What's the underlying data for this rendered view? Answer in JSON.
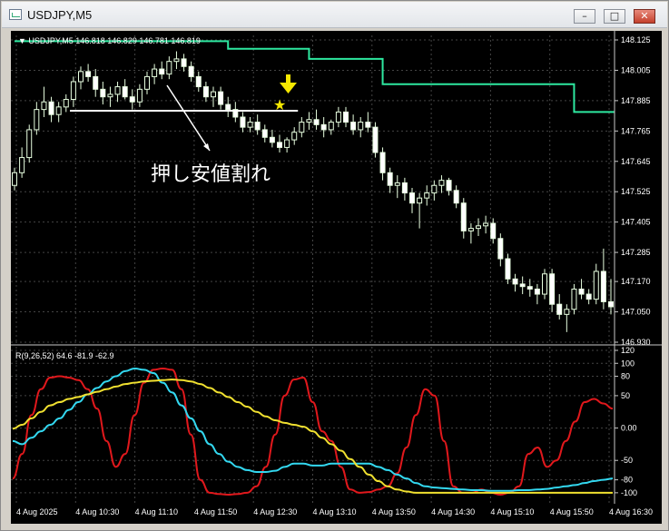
{
  "window": {
    "title": "USDJPY,M5",
    "buttons": {
      "minimize": "–",
      "maximize": "□",
      "close": "✕"
    }
  },
  "price_panel": {
    "header": "▼ USDJPY,M5  146.818 146.829 146.781 146.819"
  },
  "indicator_panel": {
    "header": "R(9,26,52) 64.6 -81.9 -62.9"
  },
  "annotations": {
    "text": "押し安値割れ",
    "star": "★",
    "down_arrow": "down-arrow"
  },
  "colors": {
    "background": "#000000",
    "grid": "#444444",
    "bull_candle": "#e8ffe0",
    "bear_candle": "#ffffff",
    "resistance_line": "#2ee8a0",
    "rci_short": "#e0181c",
    "rci_mid": "#33d8f0",
    "rci_long": "#f0e030",
    "annotation": "#f6e800"
  },
  "chart_data": [
    {
      "type": "candlestick",
      "title": "USDJPY,M5",
      "ylim": [
        146.93,
        148.125
      ],
      "y_ticks": [
        "148.125",
        "148.005",
        "147.885",
        "147.765",
        "147.645",
        "147.525",
        "147.405",
        "147.285",
        "147.170",
        "147.050",
        "146.930"
      ],
      "x_ticks": [
        "4 Aug 2025",
        "4 Aug 10:30",
        "4 Aug 11:10",
        "4 Aug 11:50",
        "4 Aug 12:30",
        "4 Aug 13:10",
        "4 Aug 13:50",
        "4 Aug 14:30",
        "4 Aug 15:10",
        "4 Aug 15:50",
        "4 Aug 16:30"
      ],
      "grid": true,
      "series": [
        {
          "name": "candles",
          "ohlc": [
            [
              147.55,
              147.62,
              147.53,
              147.6
            ],
            [
              147.6,
              147.7,
              147.58,
              147.66
            ],
            [
              147.66,
              147.79,
              147.64,
              147.77
            ],
            [
              147.77,
              147.88,
              147.75,
              147.85
            ],
            [
              147.85,
              147.94,
              147.82,
              147.88
            ],
            [
              147.88,
              147.9,
              147.8,
              147.83
            ],
            [
              147.83,
              147.88,
              147.8,
              147.86
            ],
            [
              147.86,
              147.91,
              147.84,
              147.89
            ],
            [
              147.89,
              147.98,
              147.86,
              147.96
            ],
            [
              147.96,
              148.02,
              147.93,
              148.0
            ],
            [
              148.0,
              148.03,
              147.96,
              147.98
            ],
            [
              147.98,
              148.01,
              147.9,
              147.93
            ],
            [
              147.93,
              147.96,
              147.87,
              147.9
            ],
            [
              147.9,
              147.94,
              147.86,
              147.91
            ],
            [
              147.91,
              147.96,
              147.88,
              147.94
            ],
            [
              147.94,
              147.97,
              147.89,
              147.9
            ],
            [
              147.9,
              147.93,
              147.85,
              147.88
            ],
            [
              147.88,
              147.95,
              147.86,
              147.93
            ],
            [
              147.93,
              148.0,
              147.91,
              147.98
            ],
            [
              147.98,
              148.03,
              147.95,
              148.01
            ],
            [
              148.01,
              148.04,
              147.97,
              147.99
            ],
            [
              147.99,
              148.06,
              147.97,
              148.04
            ],
            [
              148.04,
              148.08,
              148.01,
              148.05
            ],
            [
              148.05,
              148.07,
              148.0,
              148.02
            ],
            [
              148.02,
              148.04,
              147.96,
              147.98
            ],
            [
              147.98,
              148.0,
              147.92,
              147.94
            ],
            [
              147.94,
              147.96,
              147.88,
              147.9
            ],
            [
              147.9,
              147.94,
              147.86,
              147.92
            ],
            [
              147.92,
              147.94,
              147.85,
              147.87
            ],
            [
              147.87,
              147.9,
              147.82,
              147.85
            ],
            [
              147.85,
              147.88,
              147.8,
              147.82
            ],
            [
              147.82,
              147.84,
              147.76,
              147.78
            ],
            [
              147.78,
              147.82,
              147.76,
              147.8
            ],
            [
              147.8,
              147.83,
              147.75,
              147.77
            ],
            [
              147.77,
              147.79,
              147.72,
              147.74
            ],
            [
              147.74,
              147.77,
              147.7,
              147.72
            ],
            [
              147.72,
              147.75,
              147.68,
              147.7
            ],
            [
              147.7,
              147.74,
              147.68,
              147.73
            ],
            [
              147.73,
              147.78,
              147.71,
              147.76
            ],
            [
              147.76,
              147.82,
              147.74,
              147.8
            ],
            [
              147.8,
              147.84,
              147.77,
              147.81
            ],
            [
              147.81,
              147.85,
              147.77,
              147.79
            ],
            [
              147.79,
              147.82,
              147.74,
              147.77
            ],
            [
              147.77,
              147.81,
              147.75,
              147.8
            ],
            [
              147.8,
              147.86,
              147.78,
              147.84
            ],
            [
              147.84,
              147.86,
              147.78,
              147.8
            ],
            [
              147.8,
              147.83,
              147.75,
              147.77
            ],
            [
              147.77,
              147.82,
              147.74,
              147.8
            ],
            [
              147.8,
              147.84,
              147.76,
              147.78
            ],
            [
              147.78,
              147.8,
              147.66,
              147.68
            ],
            [
              147.68,
              147.7,
              147.57,
              147.6
            ],
            [
              147.6,
              147.62,
              147.52,
              147.55
            ],
            [
              147.55,
              147.59,
              147.5,
              147.56
            ],
            [
              147.56,
              147.58,
              147.49,
              147.52
            ],
            [
              147.52,
              147.54,
              147.44,
              147.48
            ],
            [
              147.48,
              147.52,
              147.38,
              147.5
            ],
            [
              147.5,
              147.55,
              147.47,
              147.52
            ],
            [
              147.52,
              147.57,
              147.49,
              147.55
            ],
            [
              147.55,
              147.59,
              147.52,
              147.57
            ],
            [
              147.57,
              147.58,
              147.51,
              147.53
            ],
            [
              147.53,
              147.55,
              147.46,
              147.48
            ],
            [
              147.48,
              147.5,
              147.34,
              147.37
            ],
            [
              147.37,
              147.4,
              147.32,
              147.38
            ],
            [
              147.38,
              147.42,
              147.35,
              147.39
            ],
            [
              147.39,
              147.43,
              147.36,
              147.4
            ],
            [
              147.4,
              147.42,
              147.32,
              147.34
            ],
            [
              147.34,
              147.36,
              147.23,
              147.26
            ],
            [
              147.26,
              147.28,
              147.16,
              147.18
            ],
            [
              147.18,
              147.2,
              147.13,
              147.16
            ],
            [
              147.16,
              147.19,
              147.12,
              147.15
            ],
            [
              147.15,
              147.18,
              147.11,
              147.14
            ],
            [
              147.14,
              147.16,
              147.08,
              147.12
            ],
            [
              147.12,
              147.22,
              147.1,
              147.2
            ],
            [
              147.2,
              147.22,
              147.05,
              147.08
            ],
            [
              147.08,
              147.12,
              147.02,
              147.04
            ],
            [
              147.04,
              147.08,
              146.97,
              147.06
            ],
            [
              147.06,
              147.16,
              147.04,
              147.14
            ],
            [
              147.14,
              147.18,
              147.1,
              147.12
            ],
            [
              147.12,
              147.14,
              147.08,
              147.1
            ],
            [
              147.1,
              147.24,
              147.08,
              147.21
            ],
            [
              147.21,
              147.3,
              147.06,
              147.09
            ],
            [
              147.09,
              147.18,
              147.04,
              147.07
            ]
          ]
        },
        {
          "name": "resistance",
          "values": [
            148.12,
            148.12,
            148.12,
            148.12,
            148.12,
            148.12,
            148.12,
            148.12,
            148.12,
            148.12,
            148.12,
            148.12,
            148.12,
            148.12,
            148.12,
            148.12,
            148.12,
            148.12,
            148.12,
            148.12,
            148.12,
            148.12,
            148.12,
            148.12,
            148.12,
            148.12,
            148.12,
            148.12,
            148.12,
            148.09,
            148.09,
            148.09,
            148.09,
            148.09,
            148.09,
            148.09,
            148.09,
            148.09,
            148.09,
            148.09,
            148.05,
            148.05,
            148.05,
            148.05,
            148.05,
            148.05,
            148.05,
            148.05,
            148.05,
            148.05,
            147.95,
            147.95,
            147.95,
            147.95,
            147.95,
            147.95,
            147.95,
            147.95,
            147.95,
            147.95,
            147.95,
            147.95,
            147.95,
            147.95,
            147.95,
            147.95,
            147.95,
            147.95,
            147.95,
            147.95,
            147.95,
            147.95,
            147.95,
            147.95,
            147.95,
            147.95,
            147.84,
            147.84,
            147.84,
            147.84,
            147.84,
            147.84
          ]
        }
      ],
      "annotation_line": {
        "from_index": 9,
        "to_index": 38,
        "value": 147.845
      }
    },
    {
      "type": "line",
      "title": "R(9,26,52)",
      "ylim": [
        -110,
        120
      ],
      "y_ticks": [
        120,
        100,
        80,
        50,
        0,
        -50,
        -80,
        -100
      ],
      "y_tick_labels": [
        "120",
        "100",
        "80",
        "50",
        "0.00",
        "-50",
        "-80",
        "-100"
      ],
      "x_ticks": [
        "4 Aug 2025",
        "4 Aug 10:30",
        "4 Aug 11:10",
        "4 Aug 11:50",
        "4 Aug 12:30",
        "4 Aug 13:10",
        "4 Aug 13:50",
        "4 Aug 14:30",
        "4 Aug 15:10",
        "4 Aug 15:50",
        "4 Aug 16:30"
      ],
      "grid": true,
      "series": [
        {
          "name": "9",
          "values": [
            -78,
            -40,
            20,
            60,
            78,
            80,
            78,
            74,
            60,
            30,
            -20,
            -60,
            -40,
            20,
            70,
            90,
            92,
            90,
            60,
            -10,
            -80,
            -100,
            -102,
            -103,
            -102,
            -100,
            -90,
            -60,
            -10,
            50,
            75,
            78,
            40,
            -5,
            -20,
            -60,
            -95,
            -100,
            -99,
            -95,
            -90,
            -70,
            -30,
            20,
            60,
            50,
            -20,
            -90,
            -100,
            -100,
            -95,
            -100,
            -103,
            -100,
            -90,
            -40,
            -30,
            -60,
            -50,
            -20,
            10,
            40,
            45,
            38,
            30
          ]
        },
        {
          "name": "26",
          "values": [
            -20,
            -25,
            -15,
            -5,
            5,
            15,
            28,
            40,
            52,
            62,
            72,
            80,
            88,
            92,
            90,
            85,
            70,
            55,
            35,
            15,
            -5,
            -25,
            -40,
            -52,
            -60,
            -65,
            -68,
            -68,
            -66,
            -60,
            -55,
            -55,
            -58,
            -58,
            -55,
            -55,
            -55,
            -55,
            -55,
            -60,
            -65,
            -72,
            -78,
            -85,
            -90,
            -92,
            -93,
            -94,
            -95,
            -96,
            -96,
            -97,
            -97,
            -97,
            -96,
            -96,
            -95,
            -94,
            -92,
            -90,
            -88,
            -85,
            -82,
            -80,
            -78
          ]
        },
        {
          "name": "52",
          "values": [
            -1,
            5,
            15,
            25,
            35,
            40,
            45,
            48,
            52,
            56,
            60,
            64,
            68,
            70,
            72,
            73,
            74,
            75,
            74,
            72,
            68,
            62,
            55,
            48,
            40,
            33,
            25,
            18,
            12,
            8,
            5,
            2,
            -5,
            -15,
            -25,
            -35,
            -48,
            -60,
            -72,
            -82,
            -90,
            -95,
            -98,
            -100,
            -100,
            -100,
            -100,
            -100,
            -100,
            -100,
            -100,
            -100,
            -100,
            -100,
            -100,
            -100,
            -100,
            -100,
            -100,
            -100,
            -100,
            -100,
            -100,
            -100,
            -100
          ]
        }
      ]
    }
  ]
}
